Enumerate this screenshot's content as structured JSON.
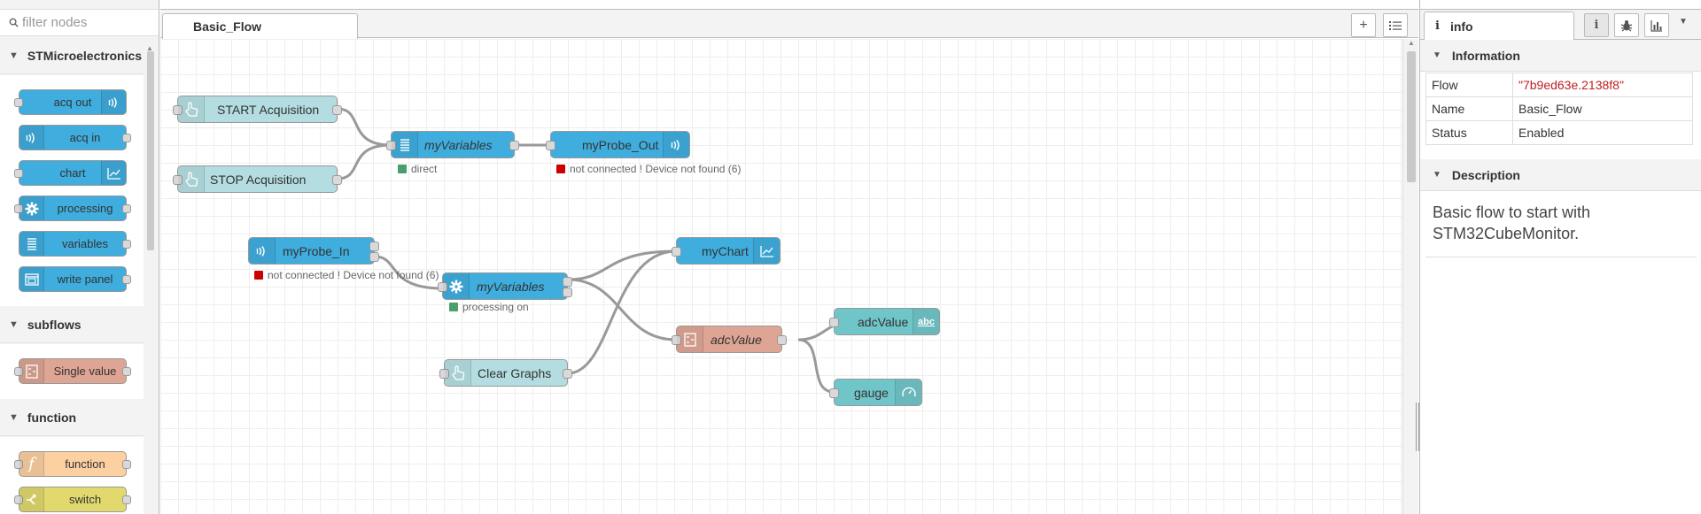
{
  "palette": {
    "search_placeholder": "filter nodes",
    "categories": [
      {
        "label": "STMicroelectronics",
        "nodes": [
          {
            "label": "acq out",
            "color": "#3fadde",
            "icon": "wifi-icon",
            "icon_side": "right"
          },
          {
            "label": "acq in",
            "color": "#3fadde",
            "icon": "wifi-icon",
            "icon_side": "left"
          },
          {
            "label": "chart",
            "color": "#3fadde",
            "icon": "chart-icon",
            "icon_side": "right"
          },
          {
            "label": "processing",
            "color": "#3fadde",
            "icon": "gear-icon",
            "icon_side": "left"
          },
          {
            "label": "variables",
            "color": "#3fadde",
            "icon": "list-icon",
            "icon_side": "left"
          },
          {
            "label": "write panel",
            "color": "#3fadde",
            "icon": "panel-icon",
            "icon_side": "left"
          }
        ]
      },
      {
        "label": "subflows",
        "nodes": [
          {
            "label": "Single value",
            "color": "#dea594",
            "icon": "subflow-icon",
            "icon_side": "left"
          }
        ]
      },
      {
        "label": "function",
        "nodes": [
          {
            "label": "function",
            "color": "#fdd0a2",
            "icon": "function-icon",
            "icon_side": "left"
          },
          {
            "label": "switch",
            "color": "#e2d96e",
            "icon": "switch-icon",
            "icon_side": "left"
          }
        ]
      }
    ]
  },
  "workspace": {
    "tab_label": "Basic_Flow",
    "add_button": "+",
    "nodes": {
      "start_acquisition": {
        "label": "START Acquisition",
        "color": "#b3dde0"
      },
      "stop_acquisition": {
        "label": "STOP Acquisition",
        "color": "#b3dde0"
      },
      "my_variables_1": {
        "label": "myVariables",
        "color": "#3fadde"
      },
      "my_probe_out": {
        "label": "myProbe_Out",
        "color": "#3fadde"
      },
      "my_probe_in": {
        "label": "myProbe_In",
        "color": "#3fadde"
      },
      "my_variables_2": {
        "label": "myVariables",
        "color": "#3fadde"
      },
      "my_chart": {
        "label": "myChart",
        "color": "#3fadde"
      },
      "adc_value_fn": {
        "label": "adcValue",
        "color": "#dea594"
      },
      "adc_value_text": {
        "label": "adcValue",
        "color": "#70c5c8"
      },
      "gauge": {
        "label": "gauge",
        "color": "#70c5c8"
      },
      "clear_graphs": {
        "label": "Clear Graphs",
        "color": "#b3dde0"
      }
    },
    "statuses": {
      "my_variables_1": {
        "text": "direct",
        "color": "#4a9e6b"
      },
      "my_probe_out": {
        "text": "not connected ! Device not found (6)",
        "color": "#cc0000"
      },
      "my_probe_in": {
        "text": "not connected ! Device not found (6)",
        "color": "#cc0000"
      },
      "my_variables_2": {
        "text": "processing on",
        "color": "#4a9e6b"
      }
    },
    "abc_badge": "abc"
  },
  "sidebar": {
    "tab_label": "info",
    "sections": {
      "information": "Information",
      "description": "Description"
    },
    "info_rows": [
      {
        "key": "Flow",
        "value": "\"7b9ed63e.2138f8\""
      },
      {
        "key": "Name",
        "value": "Basic_Flow"
      },
      {
        "key": "Status",
        "value": "Enabled"
      }
    ],
    "description_text": "Basic flow to start with STM32CubeMonitor."
  }
}
